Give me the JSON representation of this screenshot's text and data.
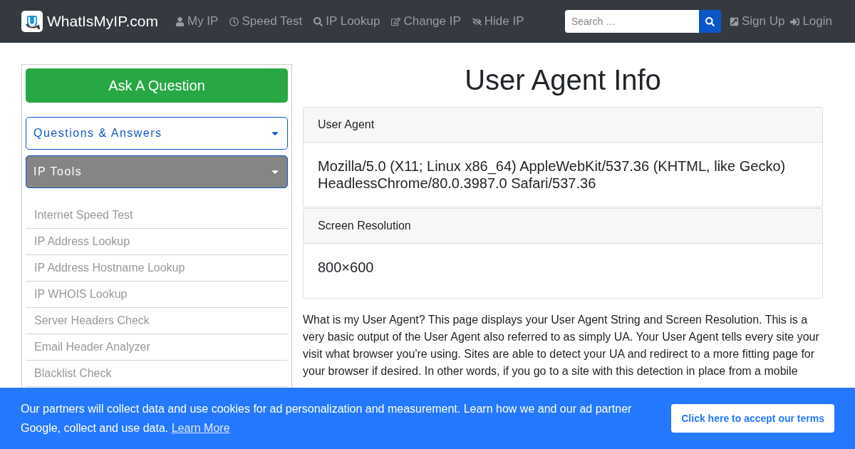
{
  "navbar": {
    "brand": "WhatIsMyIP.com",
    "links": [
      {
        "kind": "user",
        "label": "My IP"
      },
      {
        "kind": "clock",
        "label": "Speed Test"
      },
      {
        "kind": "search",
        "label": "IP Lookup"
      },
      {
        "kind": "edit",
        "label": "Change IP"
      },
      {
        "kind": "eye",
        "label": "Hide IP"
      }
    ],
    "search": {
      "placeholder": "Search …"
    },
    "account_links": [
      {
        "kind": "signup",
        "label": "Sign Up"
      },
      {
        "kind": "login",
        "label": "Login"
      }
    ]
  },
  "sidebar": {
    "ask_button": "Ask A Question",
    "sections": [
      {
        "title": "Questions & Answers",
        "expanded": false
      },
      {
        "title": "IP Tools",
        "expanded": true,
        "items": [
          "Internet Speed Test",
          "IP Address Lookup",
          "IP Address Hostname Lookup",
          "IP WHOIS Lookup",
          "Server Headers Check",
          "Email Header Analyzer",
          "Blacklist Check"
        ]
      }
    ]
  },
  "main": {
    "title": "User Agent Info",
    "cards": [
      {
        "header": "User Agent",
        "lines": [
          "Mozilla/5.0 (X11; Linux x86_64) AppleWebKit/537.36 (KHTML, like Gecko)",
          "HeadlessChrome/80.0.3987.0 Safari/537.36"
        ]
      },
      {
        "header": "Screen Resolution",
        "lines": [
          "800×600"
        ]
      }
    ],
    "paragraph": "What is my User Agent? This page displays your User Agent String and Screen Resolution. This is a very basic output of the User Agent also referred to as simply UA. Your User Agent tells every site your visit what browser you're using. Sites are able to detect your UA and redirect to a more fitting page for your browser if desired. In other words, if you go to a site with this detection in place from a mobile"
  },
  "cookie_banner": {
    "message": "Our partners will collect data and use cookies for ad personalization and measurement. Learn how we and our ad partner Google, collect and use data.",
    "link": "Learn More",
    "accept_button": "Click here to accept our terms"
  }
}
